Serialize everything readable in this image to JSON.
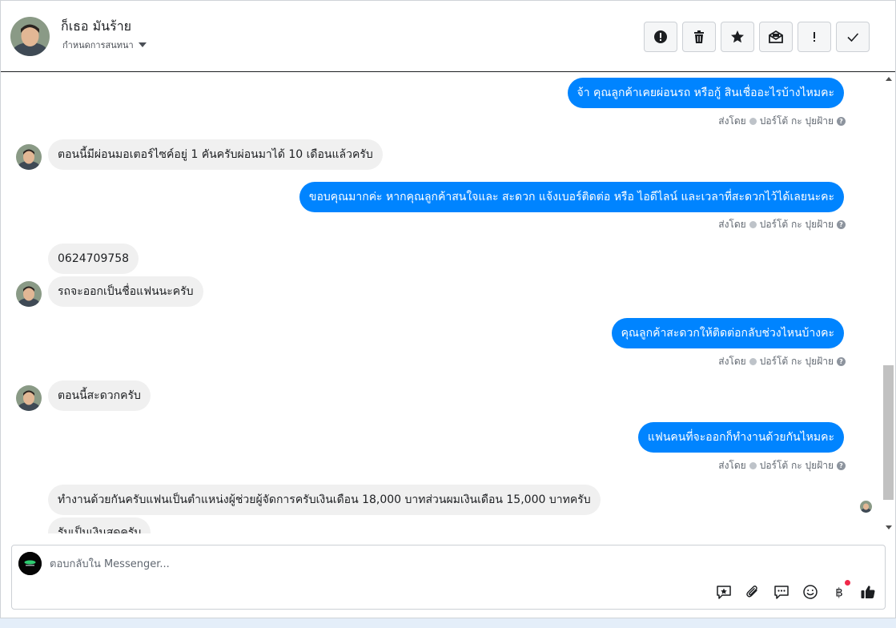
{
  "header": {
    "contact_name": "ก็เธอ มันร้าย",
    "assign_label": "กำหนดการสนทนา",
    "actions": [
      "report-icon",
      "trash-icon",
      "star-icon",
      "mark-unread-icon",
      "follow-up-icon",
      "done-icon"
    ]
  },
  "messages": [
    {
      "dir": "out",
      "text": "จ้า คุณลูกค้าเคยผ่อนรถ หรือกู้ สินเชื่ออะไรบ้างไหมคะ"
    },
    {
      "dir": "in",
      "text": "ตอนนี้มีผ่อนมอเตอร์ไซค์อยู่ 1 คันครับผ่อนมาได้ 10 เดือนแล้วครับ"
    },
    {
      "dir": "out",
      "text": "ขอบคุณมากค่ะ หากคุณลูกค้าสนใจและ สะดวก แจ้งเบอร์ติดต่อ หรือ ไอดีไลน์ และเวลาที่สะดวกไว้ได้เลยนะคะ"
    },
    {
      "dir": "in",
      "text": "0624709758"
    },
    {
      "dir": "in",
      "text": "รถจะออกเป็นชื่อแฟนนะครับ"
    },
    {
      "dir": "out",
      "text": "คุณลูกค้าสะดวกให้ติดต่อกลับช่วงไหนบ้างคะ"
    },
    {
      "dir": "in",
      "text": "ตอนนี้สะดวกครับ"
    },
    {
      "dir": "out",
      "text": "แฟนคนที่จะออกก็ทำงานด้วยกันไหมคะ"
    },
    {
      "dir": "in",
      "text": "ทำงานด้วยกันครับแฟนเป็นตำแหน่งผู้ช่วยผู้จัดการครับเงินเดือน 18,000 บาทส่วนผมเงินเดือน 15,000 บาทครับ"
    },
    {
      "dir": "in",
      "text": "รับเป็นเงินสดครับ"
    }
  ],
  "sent_by": {
    "prefix": "ส่งโดย",
    "agent": "ปอร์โต้ กะ ปุยฝ้าย"
  },
  "composer": {
    "placeholder": "ตอบกลับใน Messenger...",
    "tools": [
      "saved-reply-icon",
      "attachment-icon",
      "chat-bubble-icon",
      "emoji-icon",
      "payment-icon",
      "like-icon"
    ]
  },
  "colors": {
    "outgoing_bubble": "#0084ff",
    "incoming_bubble": "#f0f0f0",
    "notification_dot": "#f02849"
  }
}
